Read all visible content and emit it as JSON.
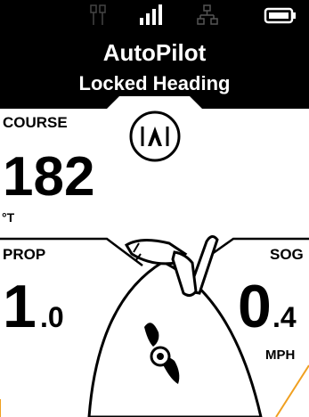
{
  "status_bar": {
    "icons": [
      "tower-icon",
      "signal-bars-icon",
      "network-icon",
      "battery-icon"
    ]
  },
  "header": {
    "title": "AutoPilot",
    "subtitle": "Locked Heading"
  },
  "autopilot_badge": {
    "symbol": "|A|"
  },
  "course": {
    "label": "COURSE",
    "value": "182",
    "unit": "°T"
  },
  "prop": {
    "label": "PROP",
    "value_int": "1",
    "value_dec": ".0"
  },
  "sog": {
    "label": "SOG",
    "value_int": "0",
    "value_dec": ".4",
    "unit": "MPH"
  },
  "colors": {
    "background": "#000000",
    "panel": "#ffffff",
    "accent_line": "#f0a020"
  }
}
